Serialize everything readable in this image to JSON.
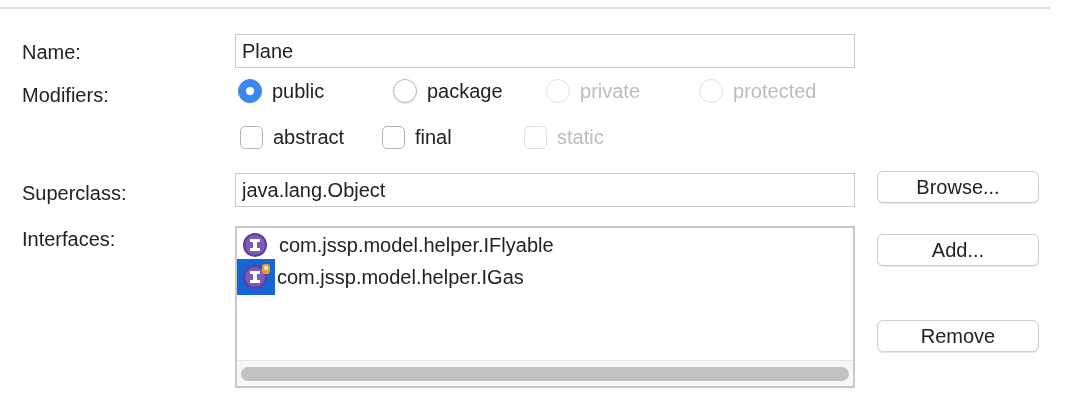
{
  "name": {
    "label": "Name:",
    "value": "Plane"
  },
  "modifiers": {
    "label": "Modifiers:",
    "access": [
      {
        "label": "public",
        "selected": true,
        "disabled": false
      },
      {
        "label": "package",
        "selected": false,
        "disabled": false
      },
      {
        "label": "private",
        "selected": false,
        "disabled": true
      },
      {
        "label": "protected",
        "selected": false,
        "disabled": true
      }
    ],
    "flags": [
      {
        "label": "abstract",
        "checked": false,
        "disabled": false
      },
      {
        "label": "final",
        "checked": false,
        "disabled": false
      },
      {
        "label": "static",
        "checked": false,
        "disabled": true
      }
    ]
  },
  "superclass": {
    "label": "Superclass:",
    "value": "java.lang.Object",
    "button": "Browse..."
  },
  "interfaces": {
    "label": "Interfaces:",
    "items": [
      {
        "name": "com.jssp.model.helper.IFlyable",
        "kind": "interface",
        "selected": false
      },
      {
        "name": "com.jssp.model.helper.IGas",
        "kind": "interface-marked",
        "selected": true
      }
    ],
    "buttons": [
      "Add...",
      "Remove"
    ]
  }
}
